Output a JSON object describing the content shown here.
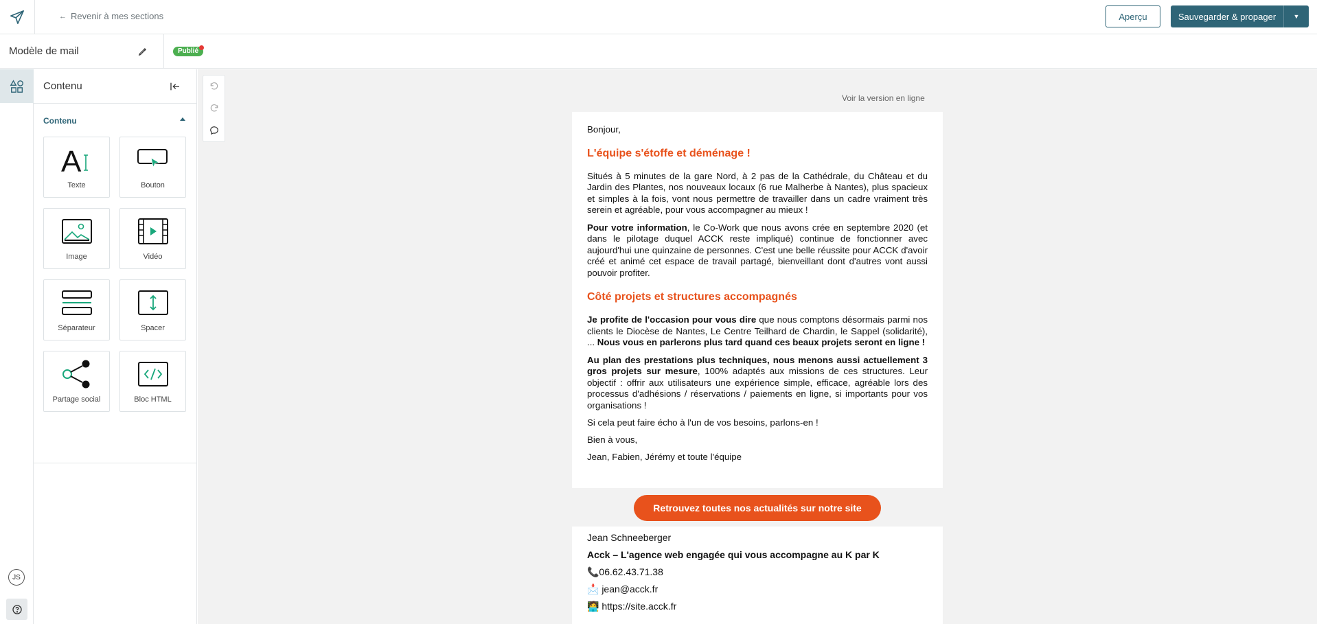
{
  "header": {
    "back_link": "Revenir à mes sections",
    "preview_label": "Aperçu",
    "save_label": "Sauvegarder & propager"
  },
  "subbar": {
    "model_name": "Modèle de mail",
    "status": "Publié"
  },
  "rail": {
    "user_initials": "JS"
  },
  "panel": {
    "title": "Contenu",
    "section_title": "Contenu",
    "tiles": [
      {
        "label": "Texte",
        "icon": "text-icon"
      },
      {
        "label": "Bouton",
        "icon": "button-icon"
      },
      {
        "label": "Image",
        "icon": "image-icon"
      },
      {
        "label": "Vidéo",
        "icon": "video-icon"
      },
      {
        "label": "Séparateur",
        "icon": "separator-icon"
      },
      {
        "label": "Spacer",
        "icon": "spacer-icon"
      },
      {
        "label": "Partage social",
        "icon": "social-share-icon"
      },
      {
        "label": "Bloc HTML",
        "icon": "html-block-icon"
      }
    ]
  },
  "email": {
    "online_version": "Voir la version en ligne",
    "greeting": "Bonjour,",
    "heading1": "L'équipe s'étoffe et déménage !",
    "para1": "Situés à 5 minutes de la gare Nord, à 2 pas de la Cathédrale, du Château et du Jardin des Plantes, nos nouveaux locaux (6 rue Malherbe à Nantes), plus spacieux et simples à la fois, vont nous permettre de travailler dans un cadre vraiment très serein et agréable, pour vous accompagner au mieux !",
    "para2_bold": "Pour votre information",
    "para2_rest": ", le Co-Work que nous avons crée en septembre 2020 (et dans le pilotage duquel ACCK reste impliqué) continue de fonctionner avec aujourd'hui une quinzaine de personnes. C'est une belle réussite pour ACCK d'avoir créé et animé cet espace de travail partagé, bienveillant dont d'autres vont aussi pouvoir profiter.",
    "heading2": "Côté projets et structures accompagnés",
    "para3_bold1": "Je profite de l'occasion pour vous dire",
    "para3_mid": " que nous comptons désormais parmi nos clients le Diocèse de Nantes, Le Centre Teilhard de Chardin, le Sappel (solidarité), ... ",
    "para3_bold2": "Nous vous en parlerons plus tard quand ces beaux projets seront en ligne !",
    "para4_bold": "Au plan des prestations plus techniques, nous menons aussi actuellement 3 gros projets sur mesure",
    "para4_rest": ", 100% adaptés aux missions de ces structures. Leur objectif : offrir aux utilisateurs une expérience simple, efficace, agréable lors des processus d'adhésions / réservations / paiements en ligne, si importants pour vos organisations !",
    "para5": "Si cela peut faire écho à l'un de vos besoins, parlons-en !",
    "para6": "Bien à vous,",
    "para7": "Jean, Fabien, Jérémy et toute l'équipe",
    "cta": "Retrouvez toutes nos actualités sur notre site",
    "sig_name": "Jean Schneeberger",
    "sig_company": "Acck – L'agence web engagée qui vous accompagne au K par K",
    "sig_phone": "📞06.62.43.71.38",
    "sig_email": "📩 jean@acck.fr",
    "sig_site": "🧑‍💻 https://site.acck.fr"
  },
  "colors": {
    "brand": "#2f6577",
    "accent": "#e8521c",
    "published": "#4caf50"
  }
}
